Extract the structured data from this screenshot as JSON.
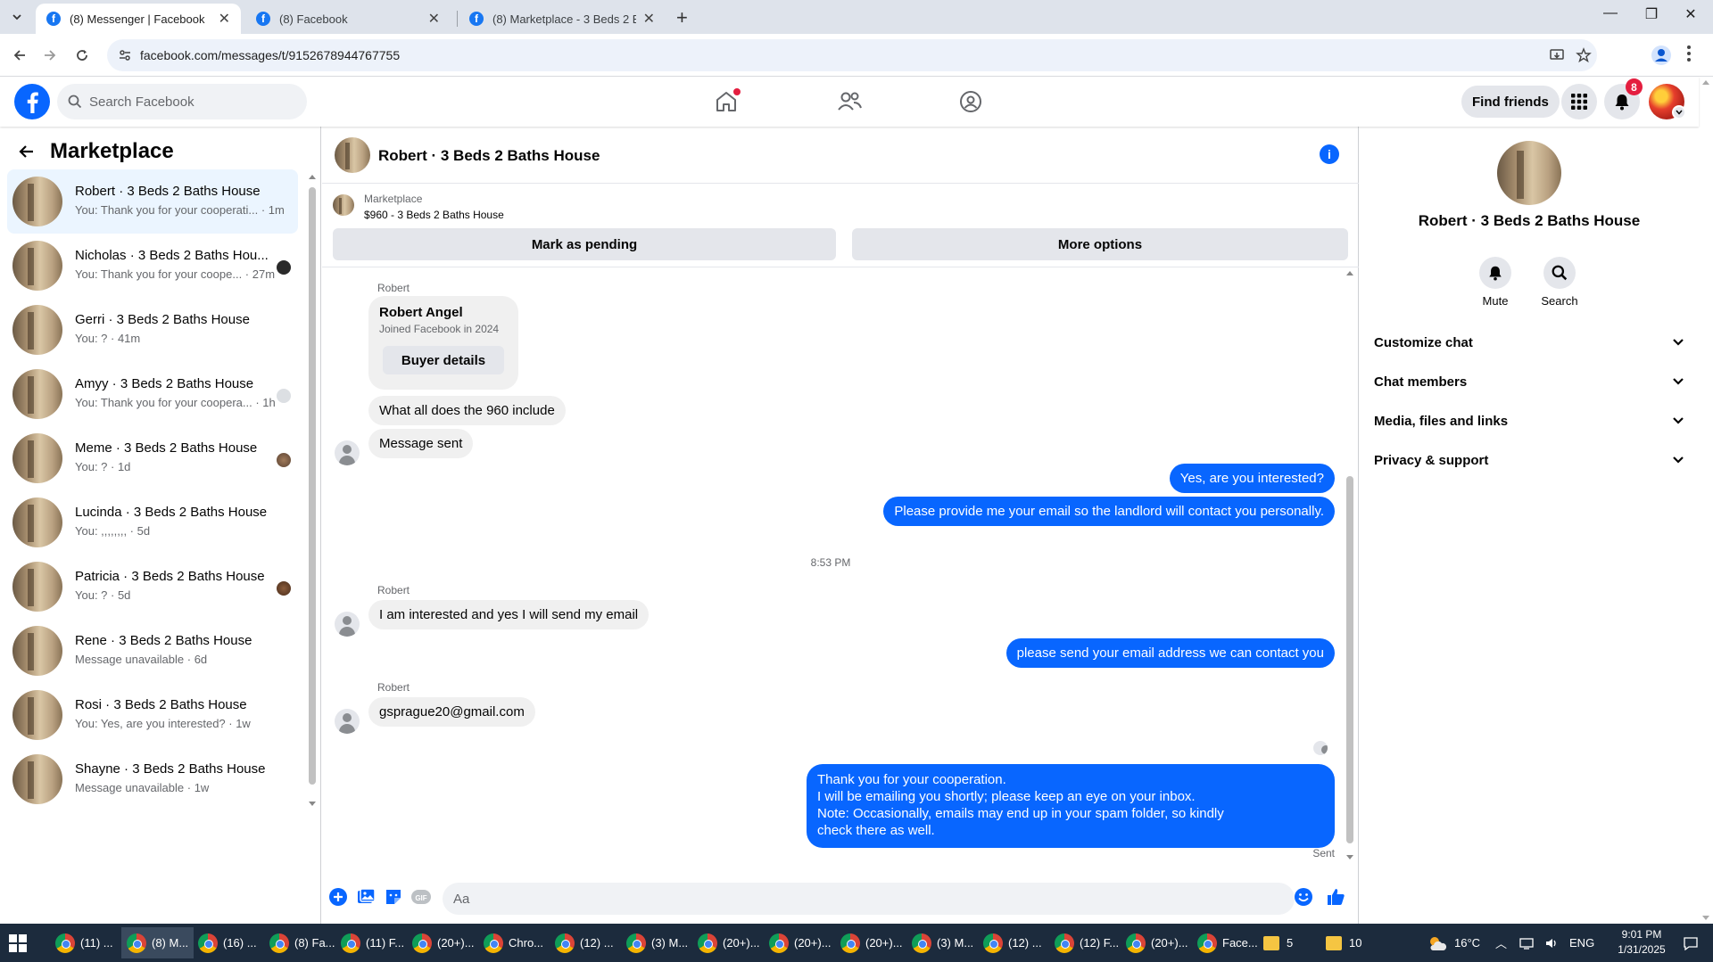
{
  "browser": {
    "tabs": [
      {
        "title": "(8) Messenger | Facebook",
        "active": true
      },
      {
        "title": "(8) Facebook",
        "active": false
      },
      {
        "title": "(8) Marketplace - 3 Beds 2 Bath",
        "active": false
      }
    ],
    "url": "facebook.com/messages/t/9152678944767755"
  },
  "header": {
    "search_placeholder": "Search Facebook",
    "find_friends": "Find friends",
    "notification_count": "8"
  },
  "left": {
    "title": "Marketplace",
    "chats": [
      {
        "name": "Robert · 3 Beds 2 Baths House",
        "preview": "You: Thank you for your cooperati... · 1m",
        "active": true
      },
      {
        "name": "Nicholas · 3 Beds 2 Baths Hou...",
        "preview": "You: Thank you for your coope... · 27m",
        "active": false
      },
      {
        "name": "Gerri · 3 Beds 2 Baths House",
        "preview": "You: ? · 41m",
        "active": false
      },
      {
        "name": "Amyy · 3 Beds 2 Baths House",
        "preview": "You: Thank you for your coopera... · 1h",
        "active": false
      },
      {
        "name": "Meme · 3 Beds 2 Baths House",
        "preview": "You: ? · 1d",
        "active": false
      },
      {
        "name": "Lucinda · 3 Beds 2 Baths House",
        "preview": "You: ,,,,,,,, · 5d",
        "active": false
      },
      {
        "name": "Patricia · 3 Beds 2 Baths House",
        "preview": "You: ? · 5d",
        "active": false
      },
      {
        "name": "Rene · 3 Beds 2 Baths House",
        "preview": "Message unavailable · 6d",
        "active": false
      },
      {
        "name": "Rosi · 3 Beds 2 Baths House",
        "preview": "You: Yes, are you interested? · 1w",
        "active": false
      },
      {
        "name": "Shayne · 3 Beds 2 Baths House",
        "preview": "Message unavailable · 1w",
        "active": false
      }
    ]
  },
  "conversation": {
    "title": "Robert · 3 Beds 2 Baths House",
    "marketplace_label": "Marketplace",
    "listing": "$960 - 3 Beds 2 Baths House",
    "mark_pending": "Mark as pending",
    "more_options": "More options",
    "card": {
      "sender": "Robert",
      "name": "Robert Angel",
      "joined": "Joined Facebook in 2024",
      "button": "Buyer details"
    },
    "msg_in_1": "What all does the 960 include",
    "msg_in_2": "Message sent",
    "msg_out_1": "Yes, are you interested?",
    "msg_out_2": "Please provide me your email so the landlord will contact you personally.",
    "timestamp": "8:53 PM",
    "sender_2": "Robert",
    "msg_in_3": "I am interested and yes I will send my email",
    "msg_out_3": "please send your email address we can contact you",
    "sender_3": "Robert",
    "msg_in_4": "gsprague20@gmail.com",
    "msg_out_4_lines": [
      "Thank you for your cooperation.",
      "I will be emailing you shortly; please keep an eye on your inbox.",
      "Note: Occasionally, emails may end up in your spam folder, so kindly",
      "check there as well."
    ],
    "sent_label": "Sent",
    "composer_placeholder": "Aa"
  },
  "right": {
    "name": "Robert · 3 Beds 2 Baths House",
    "mute": "Mute",
    "search": "Search",
    "sections": [
      "Customize chat",
      "Chat members",
      "Media, files and links",
      "Privacy & support"
    ]
  },
  "taskbar": {
    "items": [
      "(11) ...",
      "(8) M...",
      "(16) ...",
      "(8) Fa...",
      "(11) F...",
      "(20+)...",
      "Chro...",
      "(12) ...",
      "(3) M...",
      "(20+)...",
      "(20+)...",
      "(20+)...",
      "(3) M...",
      "(12) ...",
      "(12) F...",
      "(20+)...",
      "Face...",
      "5",
      "10"
    ],
    "temperature": "16°C",
    "language": "ENG",
    "time": "9:01 PM",
    "date": "1/31/2025"
  },
  "colors": {
    "brand": "#0866ff",
    "bubble_out": "#0866ff",
    "bubble_in": "#f0f0f0",
    "active_chat": "#ebf5ff"
  }
}
